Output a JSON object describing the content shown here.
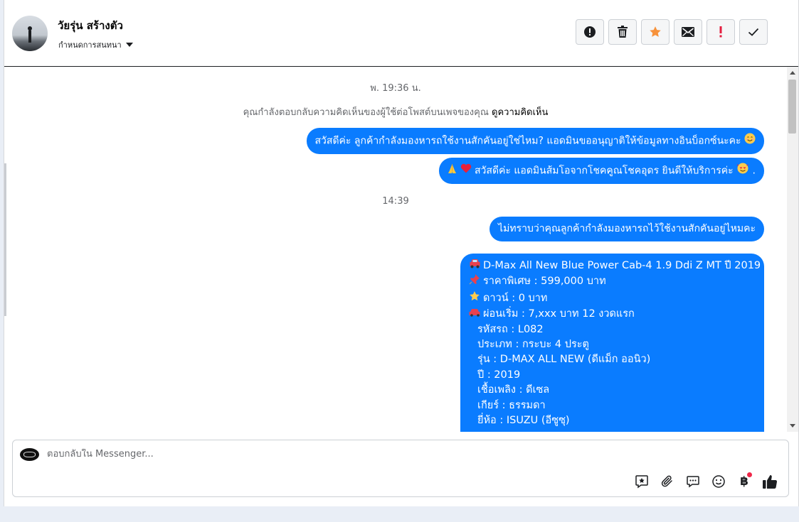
{
  "header": {
    "name": "วัยรุ่น สร้างตัว",
    "subtitle": "กำหนดการสนทนา",
    "actions": [
      {
        "icon": "alert-circle-icon"
      },
      {
        "icon": "trash-icon"
      },
      {
        "icon": "star-icon",
        "color": "#f7923b"
      },
      {
        "icon": "mail-icon"
      },
      {
        "icon": "important-icon",
        "color": "#e41e3f"
      },
      {
        "icon": "check-icon"
      }
    ]
  },
  "conversation": {
    "timestamp1": "พ. 19:36 น.",
    "notice_text": "คุณกำลังตอบกลับความคิดเห็นของผู้ใช้ต่อโพสต์บนเพจของคุณ",
    "notice_link": "ดูความคิดเห็น",
    "msg1": "สวัสดีค่ะ ลูกค้ากำลังมองหารถใช้งานสักคันอยู่ใช่ไหม? แอดมินขออนุญาติให้ข้อมูลทางอินบ็อกซ์นะคะ",
    "msg2": "สวัสดีค่ะ แอดมินส้มโอจากโชคคูณโชคอุดร ยินดีให้บริการค่ะ",
    "msg2_suffix": ".",
    "timestamp2": "14:39",
    "msg3": "ไม่ทราบว่าคุณลูกค้ากำลังมองหารถไว้ใช้งานสักคันอยู่ไหมคะ",
    "card": {
      "title": "D-Max All New Blue Power Cab-4 1.9 Ddi Z MT ปี 2019",
      "price": "ราคาพิเศษ : 599,000 บาท",
      "down": "ดาวน์ : 0 บาท",
      "installment": "ผ่อนเริ่ม : 7,xxx บาท 12 งวดแรก",
      "code": "รหัสรถ : L082",
      "type": "ประเภท : กระบะ 4 ประตู",
      "model": "รุ่น : D-MAX ALL NEW (ดีแม็ก ออนิว)",
      "year": "ปี : 2019",
      "fuel": "เชื้อเพลิง : ดีเซล",
      "gear": "เกียร์ : ธรรมดา",
      "brand": "ยี่ห้อ : ISUZU (อีซูซุ)"
    }
  },
  "composer": {
    "placeholder": "ตอบกลับใน Messenger...",
    "tools": [
      "saved-reply-icon",
      "attachment-icon",
      "chat-icon",
      "emoji-icon",
      "baht-icon",
      "thumbs-up-icon"
    ],
    "baht_symbol": "฿"
  },
  "colors": {
    "bubble": "#0a7cff",
    "star": "#f7923b",
    "important": "#e41e3f"
  }
}
